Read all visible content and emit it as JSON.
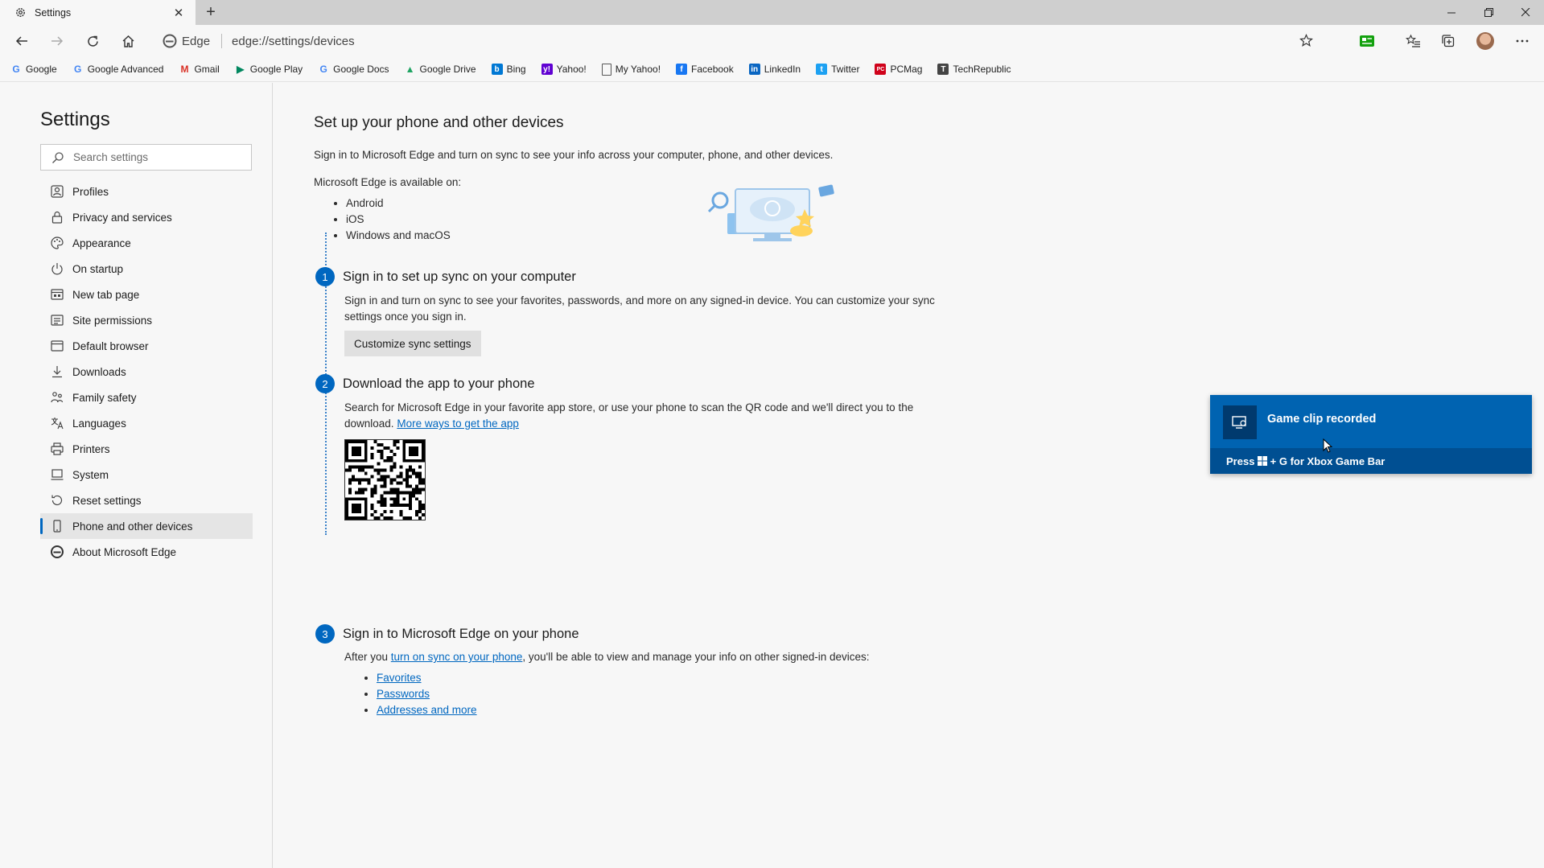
{
  "browser": {
    "tab_title": "Settings",
    "brand": "Edge",
    "url": "edge://settings/devices"
  },
  "favorites": [
    {
      "label": "Google",
      "icon": "google-icon",
      "color": "#4285f4"
    },
    {
      "label": "Google Advanced",
      "icon": "google-icon",
      "color": "#4285f4"
    },
    {
      "label": "Gmail",
      "icon": "gmail-icon",
      "color": "#d93025"
    },
    {
      "label": "Google Play",
      "icon": "google-play-icon",
      "color": "#01875f"
    },
    {
      "label": "Google Docs",
      "icon": "google-icon",
      "color": "#4285f4"
    },
    {
      "label": "Google Drive",
      "icon": "google-drive-icon",
      "color": "#1fa463"
    },
    {
      "label": "Bing",
      "icon": "bing-icon",
      "color": "#0078d4"
    },
    {
      "label": "Yahoo!",
      "icon": "yahoo-icon",
      "color": "#6001d2"
    },
    {
      "label": "My Yahoo!",
      "icon": "page-icon",
      "color": "#555555"
    },
    {
      "label": "Facebook",
      "icon": "facebook-icon",
      "color": "#1877f2"
    },
    {
      "label": "LinkedIn",
      "icon": "linkedin-icon",
      "color": "#0a66c2"
    },
    {
      "label": "Twitter",
      "icon": "twitter-icon",
      "color": "#1da1f2"
    },
    {
      "label": "PCMag",
      "icon": "pcmag-icon",
      "color": "#d0021b"
    },
    {
      "label": "TechRepublic",
      "icon": "techrepublic-icon",
      "color": "#444444"
    }
  ],
  "sidebar": {
    "title": "Settings",
    "search_placeholder": "Search settings",
    "items": [
      {
        "label": "Profiles",
        "icon": "profile-icon"
      },
      {
        "label": "Privacy and services",
        "icon": "lock-icon"
      },
      {
        "label": "Appearance",
        "icon": "palette-icon"
      },
      {
        "label": "On startup",
        "icon": "power-icon"
      },
      {
        "label": "New tab page",
        "icon": "new-tab-icon"
      },
      {
        "label": "Site permissions",
        "icon": "site-permissions-icon"
      },
      {
        "label": "Default browser",
        "icon": "browser-icon"
      },
      {
        "label": "Downloads",
        "icon": "download-icon"
      },
      {
        "label": "Family safety",
        "icon": "family-icon"
      },
      {
        "label": "Languages",
        "icon": "language-icon"
      },
      {
        "label": "Printers",
        "icon": "printer-icon"
      },
      {
        "label": "System",
        "icon": "system-icon"
      },
      {
        "label": "Reset settings",
        "icon": "reset-icon"
      },
      {
        "label": "Phone and other devices",
        "icon": "phone-icon",
        "active": true
      },
      {
        "label": "About Microsoft Edge",
        "icon": "edge-icon"
      }
    ]
  },
  "main": {
    "title": "Set up your phone and other devices",
    "intro": "Sign in to Microsoft Edge and turn on sync to see your info across your computer, phone, and other devices.",
    "available_label": "Microsoft Edge is available on:",
    "platforms": [
      "Android",
      "iOS",
      "Windows and macOS"
    ],
    "steps": [
      {
        "number": "1",
        "title": "Sign in to set up sync on your computer",
        "text_line1": "Sign in and turn on sync to see your favorites, passwords, and more on any signed-in device. You can customize your sync",
        "text_line2": "settings once you sign in.",
        "button": "Customize sync settings"
      },
      {
        "number": "2",
        "title": "Download the app to your phone",
        "text_line1": "Search for Microsoft Edge in your favorite app store, or use your phone to scan the QR code and we'll direct you to the",
        "text_line2_prefix": "download.",
        "link": "More ways to get the app"
      },
      {
        "number": "3",
        "title": "Sign in to Microsoft Edge on your phone",
        "text_prefix": "After you",
        "link": "turn on sync on your phone",
        "text_suffix": ", you'll be able to view and manage your info on other signed-in devices:",
        "items": [
          "Favorites",
          "Passwords",
          "Addresses and more"
        ]
      }
    ]
  },
  "toast": {
    "title": "Game clip recorded",
    "footer_prefix": "Press",
    "footer_suffix": "+ G for Xbox Game Bar",
    "color": "#0063b1"
  }
}
